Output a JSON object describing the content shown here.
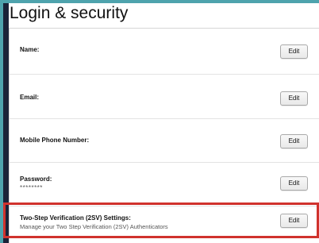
{
  "page": {
    "title": "Login & security"
  },
  "rows": [
    {
      "label": "Name:",
      "value": "",
      "edit_label": "Edit"
    },
    {
      "label": "Email:",
      "value": "",
      "edit_label": "Edit"
    },
    {
      "label": "Mobile Phone Number:",
      "value": "",
      "edit_label": "Edit"
    },
    {
      "label": "Password:",
      "value": "********",
      "edit_label": "Edit"
    },
    {
      "label": "Two-Step Verification (2SV) Settings:",
      "value": "Manage your Two Step Verification (2SV) Authenticators",
      "edit_label": "Edit"
    }
  ],
  "colors": {
    "highlight_border": "#d0322d",
    "outer_background": "#4ea3ad",
    "frame": "#1a2238"
  }
}
